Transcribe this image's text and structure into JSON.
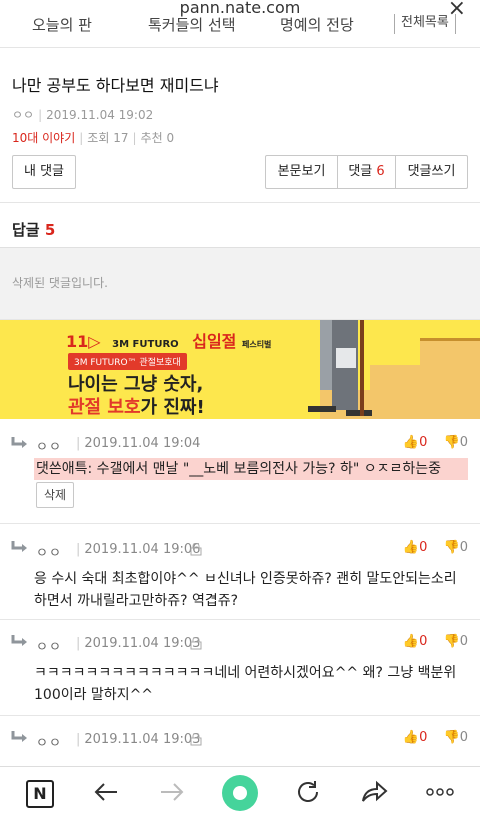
{
  "browser": {
    "url": "pann.nate.com",
    "close_label": "×"
  },
  "tabs": [
    "오늘의 판",
    "톡커들의 선택",
    "명예의 전당",
    "전체목록"
  ],
  "post": {
    "title": "나만 공부도 하다보면 재미드냐",
    "author": "ㅇㅇ",
    "date": "2019.11.04 19:02",
    "category": "10대 이야기",
    "views_label": "조회",
    "views": "17",
    "recommend_label": "추천",
    "recommend": "0"
  },
  "toolbar": {
    "my_comments": "내 댓글",
    "view_original": "본문보기",
    "comments_label": "댓글",
    "comments_count": "6",
    "write_comment": "댓글쓰기"
  },
  "replies": {
    "label": "답글",
    "count": "5"
  },
  "deleted_text": "삭제된 댓글입니다.",
  "ad": {
    "brand_num": "11",
    "brand_name": "3M FUTURO",
    "event": "십일절",
    "event_sub": "페스티벌",
    "badge": "3M FUTURO™ 관절보호대",
    "line1": "나이는 그냥 숫자,",
    "line2_red": "관절 보호",
    "line2_rest": "가 진짜!"
  },
  "comments": [
    {
      "user": "ㅇㅇ",
      "date": "2019.11.04 19:04",
      "up": "0",
      "down": "0",
      "body": "댓쓴애특: 수갤에서 맨날 \"__노베 보름의전사 가능? 하\" ㅇㅈㄹ하는중",
      "delete_label": "삭제"
    },
    {
      "user": "ㅇㅇ",
      "date": "2019.11.04 19:06",
      "up": "0",
      "down": "0",
      "body": "응 수시 숙대 최초합이야^^ ㅂ신녀나 인증못하쥬? 괜히 말도안되는소리하면서 까내릴라고만하쥬? 역겹쥬?"
    },
    {
      "user": "ㅇㅇ",
      "date": "2019.11.04 19:03",
      "up": "0",
      "down": "0",
      "body": "ㅋㅋㅋㅋㅋㅋㅋㅋㅋㅋㅋㅋㅋㅋ네네 어련하시겠어요^^ 왜? 그냥 백분위 100이라 말하지^^"
    },
    {
      "user": "ㅇㅇ",
      "date": "2019.11.04 19:03",
      "up": "0",
      "down": "0"
    }
  ],
  "nav": {
    "home_letter": "N"
  },
  "colors": {
    "accent_red": "#d9261c",
    "highlight": "#fbd3cf",
    "ad_yellow": "#fde74d",
    "nav_green": "#45d49b"
  }
}
